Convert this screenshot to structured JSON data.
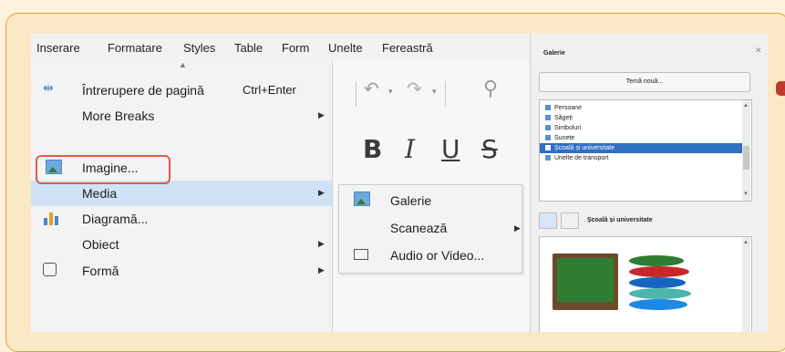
{
  "menubar": {
    "items": [
      "Inserare",
      "Formatare",
      "Styles",
      "Table",
      "Form",
      "Unelte",
      "Fereastră"
    ]
  },
  "insert_menu": {
    "items": [
      {
        "label": "Întrerupere de pagină",
        "shortcut": "Ctrl+Enter",
        "icon": "page-break-icon",
        "has_submenu": false
      },
      {
        "label": "More Breaks",
        "shortcut": "",
        "icon": "",
        "has_submenu": true
      },
      {
        "label": "Imagine...",
        "shortcut": "",
        "icon": "image-icon",
        "has_submenu": false,
        "outlined": true
      },
      {
        "label": "Media",
        "shortcut": "",
        "icon": "",
        "has_submenu": true,
        "highlighted": true
      },
      {
        "label": "Diagramă...",
        "shortcut": "",
        "icon": "chart-icon",
        "has_submenu": false
      },
      {
        "label": "Obiect",
        "shortcut": "",
        "icon": "",
        "has_submenu": true
      },
      {
        "label": "Formă",
        "shortcut": "",
        "icon": "shape-icon",
        "has_submenu": true
      }
    ]
  },
  "media_submenu": {
    "items": [
      {
        "label": "Galerie",
        "icon": "gallery-icon",
        "has_submenu": false
      },
      {
        "label": "Scanează",
        "icon": "",
        "has_submenu": true
      },
      {
        "label": "Audio or Video...",
        "icon": "audio-video-icon",
        "has_submenu": false
      }
    ]
  },
  "toolbar": {
    "bold": "B",
    "italic": "I",
    "underline": "U",
    "strike": "S"
  },
  "gallery": {
    "title": "Galerie",
    "new_theme_button": "Temă nouă...",
    "themes": [
      {
        "label": "Persoane",
        "selected": false
      },
      {
        "label": "Săgeți",
        "selected": false
      },
      {
        "label": "Simboluri",
        "selected": false
      },
      {
        "label": "Sunete",
        "selected": false
      },
      {
        "label": "Școală și universitate",
        "selected": true
      },
      {
        "label": "Unelte de transport",
        "selected": false
      }
    ],
    "current_theme": "Școală și universitate"
  },
  "colors": {
    "highlight": "#d0e3f6",
    "outline": "#e25a4a",
    "selected_theme": "#2f6fc4",
    "frame_border": "#e2a032"
  }
}
